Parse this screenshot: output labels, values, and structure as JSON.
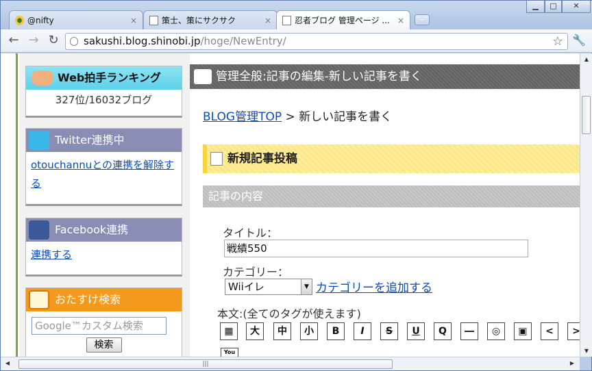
{
  "tabs": [
    {
      "title": "@nifty",
      "close": "×"
    },
    {
      "title": "策士、策にサクサク",
      "close": "×"
    },
    {
      "title": "忍者ブログ 管理ページ ...",
      "close": "×"
    }
  ],
  "window_controls": {
    "minimize": "▁",
    "maximize": "□",
    "close": "✕"
  },
  "toolbar": {
    "url_host": "sakushi.blog.shinobi.jp",
    "url_path": "/hoge/NewEntry/",
    "star": "☆",
    "wrench": "🔧",
    "back": "←",
    "forward": "→",
    "reload": "↻"
  },
  "sidebar": {
    "ranking": {
      "title": "Web拍手ランキング",
      "value": "327位/16032ブログ"
    },
    "twitter": {
      "title": "Twitter連携中",
      "link": "otouchannuとの連携を解除する"
    },
    "facebook": {
      "title": "Facebook連携",
      "link": "連携する"
    },
    "search": {
      "title": "おたすけ検索",
      "placeholder": "Google™カスタム検索",
      "button": "検索"
    }
  },
  "main": {
    "header": "管理全般:記事の編集-新しい記事を書く",
    "breadcrumb_link": "BLOG管理TOP",
    "breadcrumb_sep": " > ",
    "breadcrumb_current": "新しい記事を書く",
    "section_new": "新規記事投稿",
    "section_content": "記事の内容",
    "title_label": "タイトル：",
    "title_value": "戦績550",
    "category_label": "カテゴリー：",
    "category_value": "Wiiイレ",
    "add_category": "カテゴリーを追加する",
    "body_label": "本文:(全てのタグが使えます)",
    "tags": [
      "▦",
      "大",
      "中",
      "小",
      "B",
      "I",
      "S",
      "U",
      "Q",
      "―",
      "◎",
      "▣",
      "<",
      ">"
    ],
    "youtube": "You"
  },
  "scroll": {
    "h_grip": "|||"
  }
}
